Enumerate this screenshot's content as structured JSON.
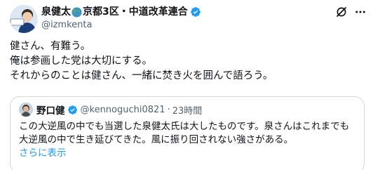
{
  "author": {
    "name_before": "泉健太",
    "name_after": "京都3区・中道改革連合",
    "handle": "@izmkenta",
    "avatar_caption": "泉健太"
  },
  "header_icons": [
    "grok-icon",
    "more-icon"
  ],
  "tweet": {
    "lines": [
      "健さん、有難う。",
      "俺は参画した党は大切にする。",
      "それからのことは健さん、一緒に焚き火を囲んで語ろう。"
    ]
  },
  "quote": {
    "name": "野口健",
    "handle": "@kennoguchi0821",
    "separator": "·",
    "time": "23時間",
    "lines": [
      "この大逆風の中でも当選した泉健太氏は大したものです。泉さんはこれまでも",
      "大逆風の中で生き延びてきた。風に振り回されない強さがある。"
    ],
    "show_more": "さらに表示"
  },
  "colors": {
    "text": "#0f1419",
    "secondary": "#536471",
    "link": "#1d9bf0",
    "verified": "#1d9bf0",
    "border": "#cfd9de"
  }
}
